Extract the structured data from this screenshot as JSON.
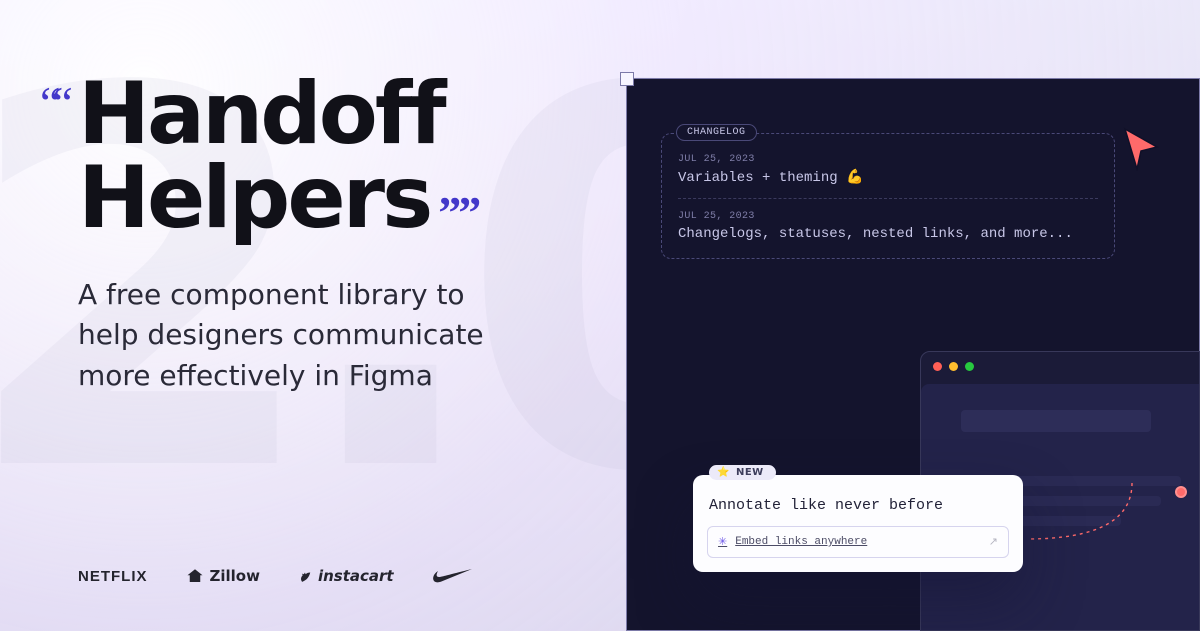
{
  "bg_glyph": "2.0",
  "hero": {
    "title_line1": "Handoff",
    "title_line2": "Helpers",
    "subtitle": "A free component library to help designers communicate more effectively in Figma",
    "quote": "““",
    "quote_close": "””"
  },
  "brands": {
    "netflix": "NETFLIX",
    "zillow": "Zillow",
    "instacart": "instacart",
    "nike": ""
  },
  "changelog": {
    "label": "CHANGELOG",
    "entries": [
      {
        "date": "JUL 25, 2023",
        "text": "Variables + theming 💪"
      },
      {
        "date": "JUL 25, 2023",
        "text": "Changelogs, statuses, nested links, and more..."
      }
    ]
  },
  "annotation": {
    "badge_text": "NEW",
    "title": "Annotate like never before",
    "link_text": "Embed links anywhere",
    "link_arrow": "↗"
  },
  "icons": {
    "cursor": "cursor",
    "star": "⭐",
    "burst": "✳"
  }
}
